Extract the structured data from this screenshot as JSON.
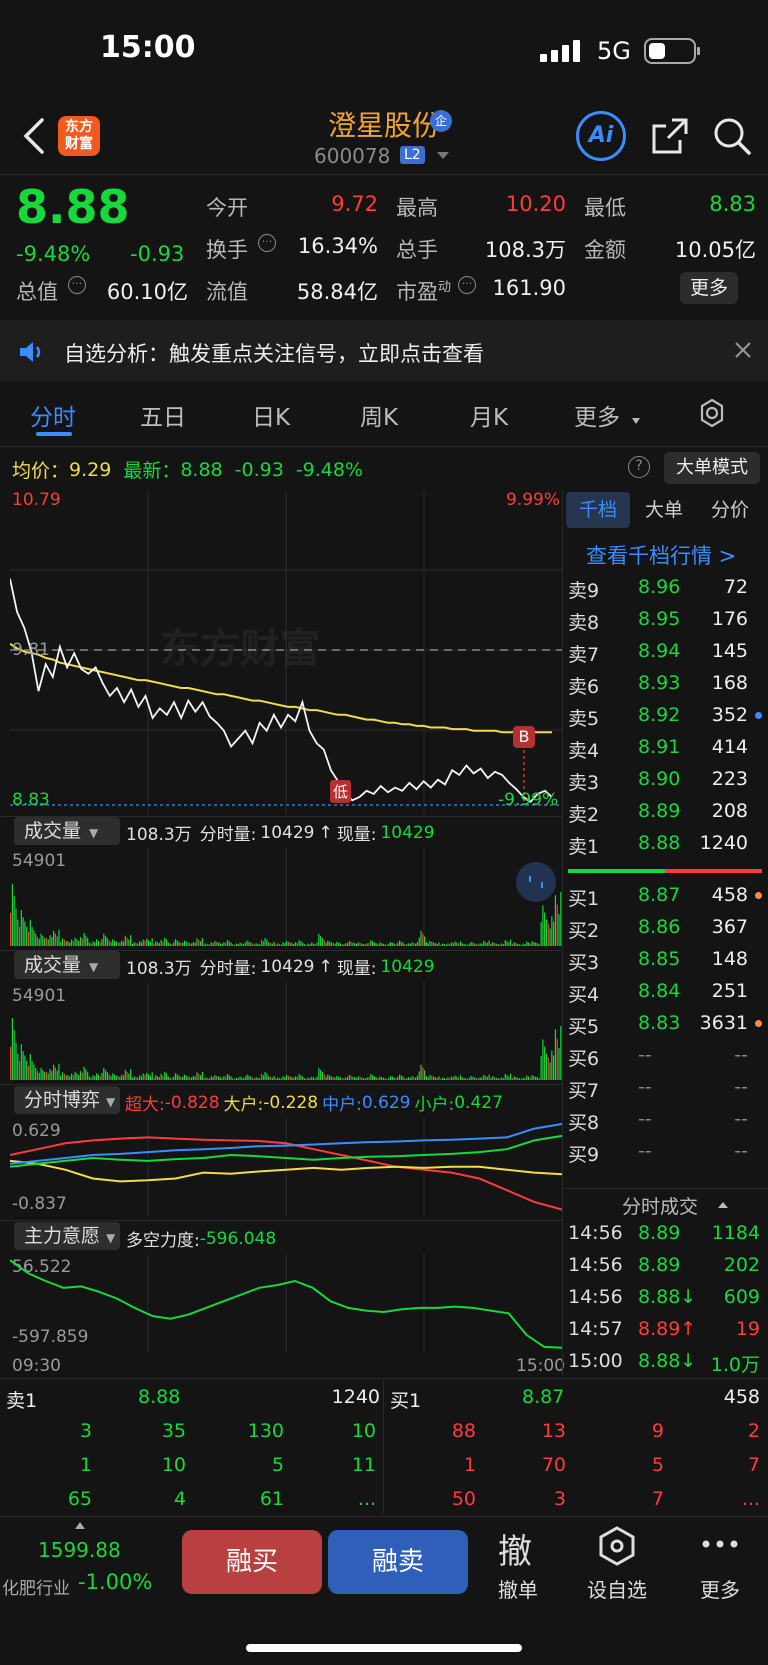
{
  "status_bar": {
    "time": "15:00",
    "network": "5G"
  },
  "header": {
    "title": "澄星股份",
    "code": "600078",
    "level_badge": "L2",
    "logo_text": [
      "东方",
      "财富"
    ],
    "title_badge": "企",
    "ai_label": "Ai"
  },
  "quote": {
    "price": "8.88",
    "change_pct": "-9.48%",
    "change": "-0.93",
    "open_label": "今开",
    "open": "9.72",
    "high_label": "最高",
    "high": "10.20",
    "low_label": "最低",
    "low": "8.83",
    "turnover_label": "换手",
    "turnover": "16.34%",
    "volume_label": "总手",
    "volume": "108.3万",
    "amount_label": "金额",
    "amount": "10.05亿",
    "mktcap_label": "总值",
    "mktcap": "60.10亿",
    "float_label": "流值",
    "float_cap": "58.84亿",
    "pe_label": "市盈",
    "pe_sup": "动",
    "pe": "161.90",
    "more_button": "更多"
  },
  "notice": {
    "text": "自选分析：触发重点关注信号，立即点击查看"
  },
  "tabs": [
    "分时",
    "五日",
    "日K",
    "周K",
    "月K",
    "更多"
  ],
  "active_tab": 0,
  "info_line": {
    "avg_label": "均价：",
    "avg": "9.29",
    "latest_label": "最新：",
    "latest": "8.88",
    "change": "-0.93",
    "pct": "-9.48%",
    "big_order_mode": "大单模式"
  },
  "chart_data": [
    {
      "type": "line",
      "name": "分时",
      "y_top_label": "10.79",
      "y_top_pct": "9.99%",
      "y_mid_label": "9.81",
      "y_low_label": "8.83",
      "y_low_pct": "-9.99%",
      "low_marker": "低",
      "b_marker": "B",
      "watermark": "东方财富",
      "ylim": [
        8.83,
        10.79
      ],
      "series": [
        {
          "values": [
            10.26,
            10.05,
            9.95,
            9.8,
            9.55,
            9.72,
            9.64,
            9.83,
            9.7,
            9.79,
            9.69,
            9.66,
            9.7,
            9.6,
            9.52,
            9.57,
            9.48,
            9.56,
            9.45,
            9.52,
            9.38,
            9.44,
            9.4,
            9.48,
            9.38,
            9.49,
            9.42,
            9.48,
            9.39,
            9.35,
            9.3,
            9.2,
            9.25,
            9.3,
            9.22,
            9.35,
            9.3,
            9.4,
            9.32,
            9.4,
            9.36,
            9.48,
            9.3,
            9.22,
            9.18,
            9.05,
            8.98,
            8.9,
            8.86,
            8.88,
            8.92,
            8.9,
            8.95,
            8.91,
            8.94,
            8.92,
            8.97,
            8.93,
            8.98,
            8.94,
            8.99,
            8.96,
            9.05,
            9.02,
            9.08,
            9.03,
            9.06,
            9.0,
            9.04,
            9.02,
            8.97,
            8.93,
            8.88,
            8.85,
            8.9,
            8.92,
            8.88
          ]
        },
        {
          "values": [
            9.85,
            9.82,
            9.8,
            9.79,
            9.78,
            9.76,
            9.75,
            9.73,
            9.72,
            9.71,
            9.7,
            9.69,
            9.68,
            9.67,
            9.66,
            9.65,
            9.64,
            9.63,
            9.62,
            9.62,
            9.61,
            9.6,
            9.59,
            9.58,
            9.57,
            9.57,
            9.56,
            9.55,
            9.54,
            9.53,
            9.53,
            9.52,
            9.51,
            9.5,
            9.49,
            9.49,
            9.48,
            9.47,
            9.46,
            9.45,
            9.45,
            9.44,
            9.43,
            9.43,
            9.42,
            9.41,
            9.4,
            9.4,
            9.39,
            9.38,
            9.37,
            9.37,
            9.36,
            9.35,
            9.35,
            9.34,
            9.34,
            9.33,
            9.33,
            9.32,
            9.32,
            9.32,
            9.31,
            9.31,
            9.31,
            9.3,
            9.3,
            9.3,
            9.3,
            9.29,
            9.29,
            9.29,
            9.29,
            9.29,
            9.29,
            9.29,
            9.29
          ]
        }
      ]
    },
    {
      "type": "bar",
      "name": "成交量",
      "ymax_label": "54901",
      "ylim": [
        0,
        54901
      ],
      "values": [
        52000,
        30000,
        22000,
        14000,
        9000,
        8000,
        12000,
        6000,
        5000,
        7000,
        11000,
        4000,
        6000,
        9000,
        5000,
        4000,
        8000,
        3000,
        5000,
        6000,
        4000,
        7000,
        3000,
        5000,
        4000,
        3000,
        6000,
        2000,
        4000,
        3000,
        5000,
        2000,
        3000,
        4000,
        2000,
        6000,
        3000,
        2000,
        4000,
        3000,
        5000,
        2000,
        3000,
        9000,
        4000,
        3000,
        2000,
        4000,
        3000,
        2000,
        5000,
        3000,
        2000,
        3000,
        4000,
        2000,
        3000,
        12000,
        4000,
        3000,
        2000,
        3000,
        4000,
        2000,
        3000,
        2000,
        4000,
        3000,
        2000,
        5000,
        3000,
        2000,
        4000,
        3000,
        30000,
        22000,
        40000
      ]
    },
    {
      "type": "line",
      "name": "分时博弈",
      "ymax_label": "0.629",
      "ymin_label": "-0.837",
      "ylim": [
        -0.837,
        0.629
      ],
      "series": [
        {
          "name": "超大",
          "values": [
            0.1,
            0.2,
            0.3,
            0.35,
            0.38,
            0.4,
            0.38,
            0.36,
            0.35,
            0.34,
            0.3,
            0.2,
            0.1,
            0.0,
            -0.1,
            -0.15,
            -0.2,
            -0.3,
            -0.5,
            -0.7,
            -0.828
          ]
        },
        {
          "name": "大户",
          "values": [
            0.0,
            -0.05,
            -0.15,
            -0.3,
            -0.35,
            -0.33,
            -0.3,
            -0.2,
            -0.22,
            -0.18,
            -0.15,
            -0.12,
            -0.15,
            -0.12,
            -0.1,
            -0.12,
            -0.1,
            -0.1,
            -0.15,
            -0.2,
            -0.228
          ]
        },
        {
          "name": "中户",
          "values": [
            -0.05,
            0.0,
            0.05,
            0.1,
            0.12,
            0.15,
            0.18,
            0.2,
            0.22,
            0.25,
            0.26,
            0.28,
            0.3,
            0.32,
            0.33,
            0.35,
            0.36,
            0.38,
            0.4,
            0.55,
            0.629
          ]
        },
        {
          "name": "小户",
          "values": [
            -0.1,
            -0.05,
            0.0,
            0.05,
            0.02,
            0.0,
            0.03,
            0.05,
            0.1,
            0.08,
            0.05,
            0.02,
            0.05,
            0.07,
            0.08,
            0.1,
            0.12,
            0.15,
            0.2,
            0.35,
            0.427
          ]
        }
      ]
    },
    {
      "type": "line",
      "name": "主力意愿",
      "ymax_label": "56.522",
      "ymin_label": "-597.859",
      "x_start": "09:30",
      "x_end": "15:00",
      "ylim": [
        -597.859,
        56.522
      ],
      "values": [
        56,
        -40,
        -100,
        -150,
        -140,
        -180,
        -230,
        -300,
        -360,
        -380,
        -350,
        -300,
        -250,
        -200,
        -150,
        -130,
        -100,
        -150,
        -250,
        -300,
        -320,
        -330,
        -310,
        -300,
        -300,
        -290,
        -300,
        -320,
        -340,
        -500,
        -590,
        -596
      ]
    }
  ],
  "volume_panel": {
    "label": "成交量",
    "total": "108.3万",
    "fs_label": "分时量:",
    "fs_value": "10429",
    "arrow": "↑",
    "now_label": "现量:",
    "now_value": "10429"
  },
  "game_panel": {
    "label": "分时博弈",
    "items": [
      {
        "name": "超大:",
        "value": "-0.828",
        "color": "#ff3b3b"
      },
      {
        "name": "大户:",
        "value": "-0.228",
        "color": "#f2dc4a"
      },
      {
        "name": "中户:",
        "value": "0.629",
        "color": "#3b8dff"
      },
      {
        "name": "小户:",
        "value": "0.427",
        "color": "#16d93c"
      }
    ]
  },
  "intent_panel": {
    "label": "主力意愿",
    "strength_label": "多空力度:",
    "strength": "-596.048"
  },
  "depth": {
    "tabs": [
      "千档",
      "大单",
      "分价"
    ],
    "link": "查看千档行情 >",
    "asks": [
      {
        "label": "卖9",
        "price": "8.96",
        "vol": "72"
      },
      {
        "label": "卖8",
        "price": "8.95",
        "vol": "176"
      },
      {
        "label": "卖7",
        "price": "8.94",
        "vol": "145"
      },
      {
        "label": "卖6",
        "price": "8.93",
        "vol": "168"
      },
      {
        "label": "卖5",
        "price": "8.92",
        "vol": "352"
      },
      {
        "label": "卖4",
        "price": "8.91",
        "vol": "414"
      },
      {
        "label": "卖3",
        "price": "8.90",
        "vol": "223"
      },
      {
        "label": "卖2",
        "price": "8.89",
        "vol": "208"
      },
      {
        "label": "卖1",
        "price": "8.88",
        "vol": "1240"
      }
    ],
    "bids": [
      {
        "label": "买1",
        "price": "8.87",
        "vol": "458"
      },
      {
        "label": "买2",
        "price": "8.86",
        "vol": "367"
      },
      {
        "label": "买3",
        "price": "8.85",
        "vol": "148"
      },
      {
        "label": "买4",
        "price": "8.84",
        "vol": "251"
      },
      {
        "label": "买5",
        "price": "8.83",
        "vol": "3631"
      },
      {
        "label": "买6",
        "price": "--",
        "vol": "--"
      },
      {
        "label": "买7",
        "price": "--",
        "vol": "--"
      },
      {
        "label": "买8",
        "price": "--",
        "vol": "--"
      },
      {
        "label": "买9",
        "price": "--",
        "vol": "--"
      }
    ],
    "ticks_title": "分时成交",
    "ticks": [
      {
        "time": "14:56",
        "price": "8.89",
        "vol": "1184"
      },
      {
        "time": "14:56",
        "price": "8.89",
        "vol": "202"
      },
      {
        "time": "14:56",
        "price": "8.88↓",
        "vol": "609"
      },
      {
        "time": "14:57",
        "price": "8.89↑",
        "vol": "19"
      },
      {
        "time": "15:00",
        "price": "8.88↓",
        "vol": "1.0万"
      }
    ]
  },
  "queue": {
    "sell_label": "卖1",
    "sell_price": "8.88",
    "sell_vol": "1240",
    "buy_label": "买1",
    "buy_price": "8.87",
    "buy_vol": "458",
    "sell_rows": [
      [
        "3",
        "35",
        "130",
        "10"
      ],
      [
        "1",
        "10",
        "5",
        "11"
      ],
      [
        "65",
        "4",
        "61",
        "..."
      ]
    ],
    "buy_rows": [
      [
        "88",
        "13",
        "9",
        "2"
      ],
      [
        "1",
        "70",
        "5",
        "7"
      ],
      [
        "50",
        "3",
        "7",
        "..."
      ]
    ]
  },
  "bottom": {
    "index_value": "1599.88",
    "index_name": "化肥行业",
    "index_pct": "-1.00%",
    "buy_button": "融买",
    "sell_button": "融卖",
    "cancel_icon_text": "撤",
    "cancel_label": "撤单",
    "watch_label": "设自选",
    "more_label": "更多"
  },
  "colors": {
    "up": "#ff3b3b",
    "down": "#16d93c",
    "avg": "#f2dc4a",
    "accent": "#3b8dff",
    "brand": "#f05a1e"
  }
}
